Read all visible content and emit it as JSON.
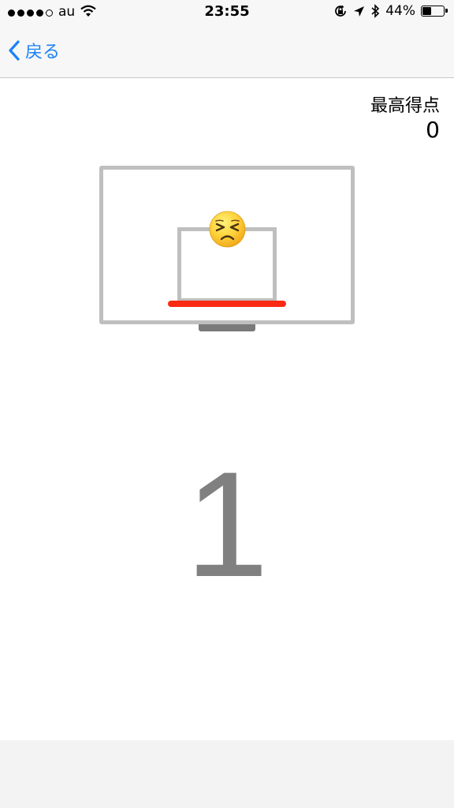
{
  "status_bar": {
    "carrier": "au",
    "time": "23:55",
    "battery_percent": "44%",
    "battery_level": 0.44,
    "signal_bars_filled": 4,
    "signal_bars_total": 5
  },
  "nav": {
    "back_label": "戻る"
  },
  "game": {
    "best_score_label": "最高得点",
    "best_score_value": "0",
    "current_score": "1",
    "ball_icon": "persevering-face-emoji",
    "colors": {
      "hoop": "#fa2a14",
      "board": "#bfbfbf",
      "back_accent": "#1a82fb"
    }
  }
}
